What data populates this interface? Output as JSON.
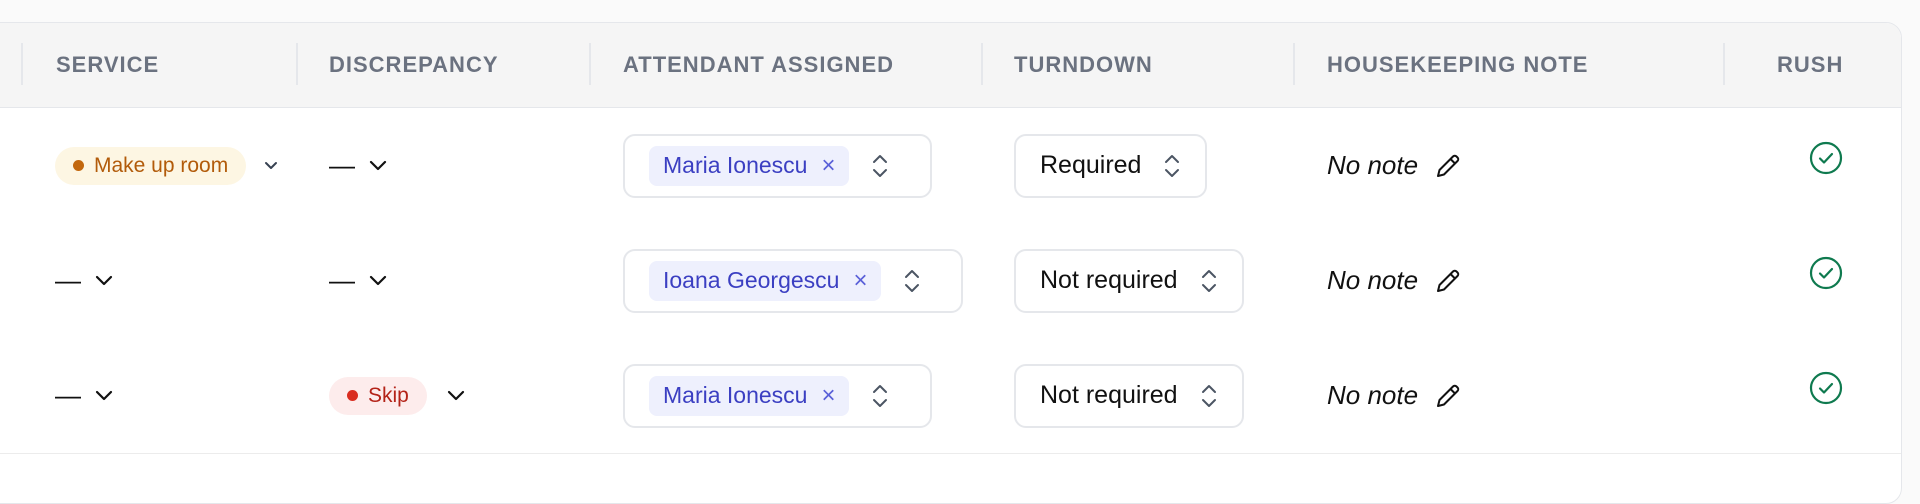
{
  "columns": {
    "service": "SERVICE",
    "discrepancy": "DISCREPANCY",
    "attendant": "ATTENDANT ASSIGNED",
    "turndown": "TURNDOWN",
    "note": "HOUSEKEEPING NOTE",
    "rush": "RUSH"
  },
  "colors": {
    "service_pill_bg": "#fdf6e3",
    "service_pill_text": "#b25b0a",
    "service_pill_dot": "#c2670d",
    "skip_pill_bg": "#fdecec",
    "skip_pill_text": "#b42318",
    "skip_pill_dot": "#d92d20",
    "tag_bg": "#eef0fd",
    "tag_text": "#3b3fc2",
    "rush_icon": "#0f7a4f"
  },
  "rows": [
    {
      "service": "Make up room",
      "discrepancy": "—",
      "attendant": "Maria Ionescu",
      "turndown": "Required",
      "note": "No note"
    },
    {
      "service": "—",
      "discrepancy": "—",
      "attendant": "Ioana Georgescu",
      "turndown": "Not required",
      "note": "No note"
    },
    {
      "service": "—",
      "discrepancy": "Skip",
      "attendant": "Maria Ionescu",
      "turndown": "Not required",
      "note": "No note"
    }
  ],
  "icons": {
    "chevron": "chevron-down-icon",
    "remove": "close-icon",
    "updown": "chevron-up-down-icon",
    "edit": "pencil-icon",
    "rush": "check-circle-icon"
  },
  "remove_glyph": "×"
}
